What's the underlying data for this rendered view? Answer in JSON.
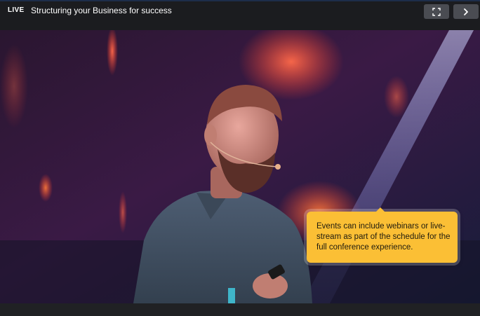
{
  "header": {
    "live_badge": "LIVE",
    "title": "Structuring your Business for success",
    "fullscreen_icon": "fullscreen-icon",
    "next_icon": "chevron-right-icon"
  },
  "video": {
    "tooltip_text": "Events can include webinars or live-stream as part of the schedule for the full conference experience."
  },
  "colors": {
    "tooltip_bg": "#fbbf35",
    "header_bg": "#1b1c1f",
    "button_bg": "#4a4c52"
  }
}
